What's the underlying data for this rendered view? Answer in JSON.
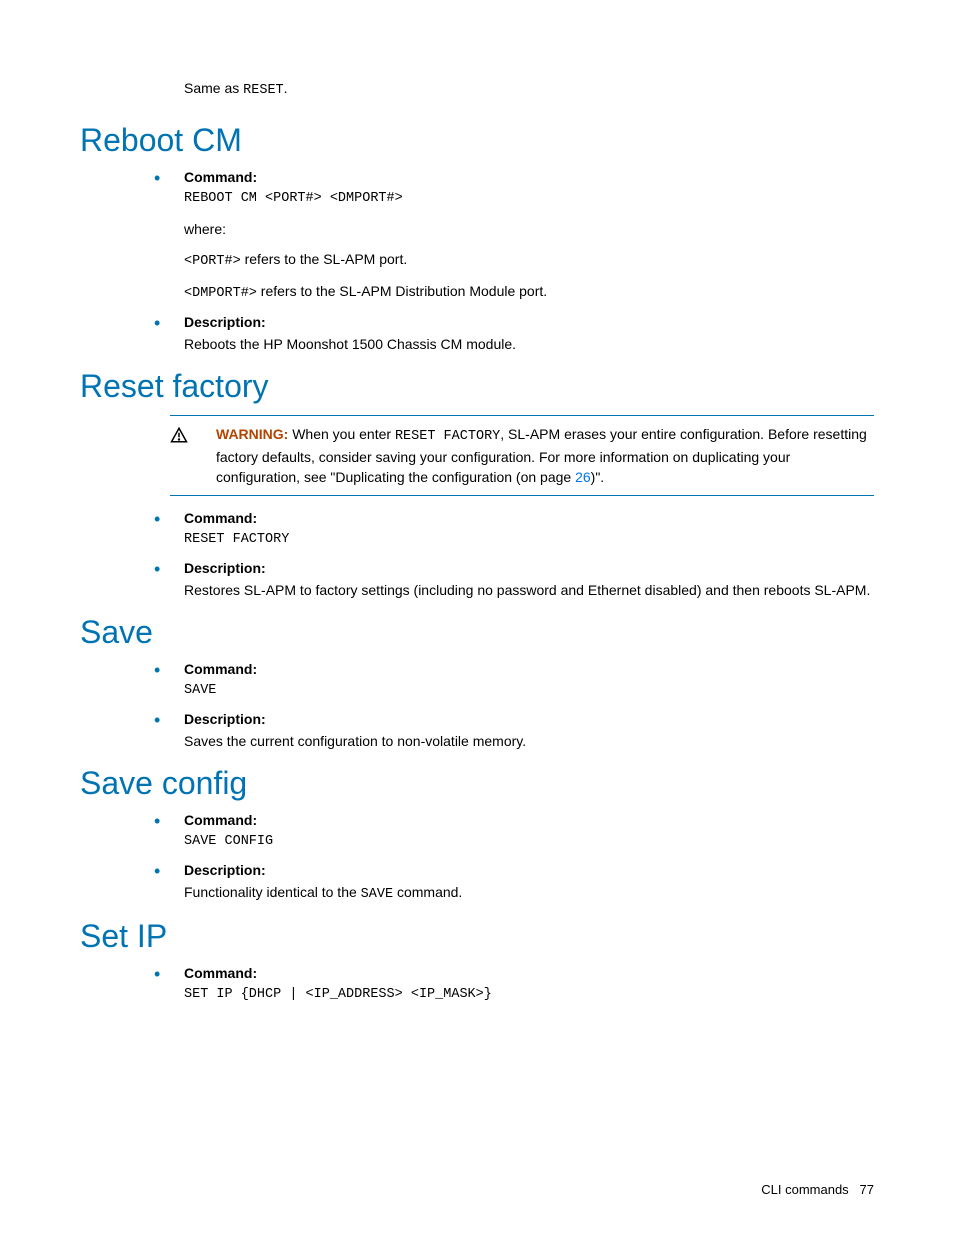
{
  "intro": {
    "prefix": "Same as ",
    "code": "RESET",
    "suffix": "."
  },
  "sections": {
    "reboot_cm": {
      "heading": "Reboot CM",
      "command_label": "Command:",
      "command_syntax": "REBOOT CM <PORT#> <DMPORT#>",
      "where": "where:",
      "port_code": "<PORT#>",
      "port_desc": " refers to the SL-APM port.",
      "dmport_code": "<DMPORT#>",
      "dmport_desc": " refers to the SL-APM Distribution Module port.",
      "description_label": "Description:",
      "description_text": "Reboots the HP Moonshot 1500 Chassis CM module."
    },
    "reset_factory": {
      "heading": "Reset factory",
      "warning_label": "WARNING:",
      "warning_p1a": "   When you enter ",
      "warning_code": "RESET FACTORY",
      "warning_p1b": ", SL-APM erases your entire configuration. Before resetting factory defaults, consider saving your configuration. For more information on duplicating your configuration, see \"Duplicating the configuration (on page ",
      "warning_link": "26",
      "warning_p1c": ")\".",
      "command_label": "Command:",
      "command_syntax": "RESET FACTORY",
      "description_label": "Description:",
      "description_text": "Restores SL-APM to factory settings (including no password and Ethernet disabled) and then reboots SL-APM."
    },
    "save": {
      "heading": "Save",
      "command_label": "Command:",
      "command_syntax": "SAVE",
      "description_label": "Description:",
      "description_text": "Saves the current configuration to non-volatile memory."
    },
    "save_config": {
      "heading": "Save config",
      "command_label": "Command:",
      "command_syntax": "SAVE CONFIG",
      "description_label": "Description:",
      "description_p1": "Functionality identical to the ",
      "description_code": "SAVE",
      "description_p2": " command."
    },
    "set_ip": {
      "heading": "Set IP",
      "command_label": "Command:",
      "command_syntax": "SET IP {DHCP | <IP_ADDRESS> <IP_MASK>}"
    }
  },
  "footer": {
    "label": "CLI commands",
    "page": "77"
  }
}
